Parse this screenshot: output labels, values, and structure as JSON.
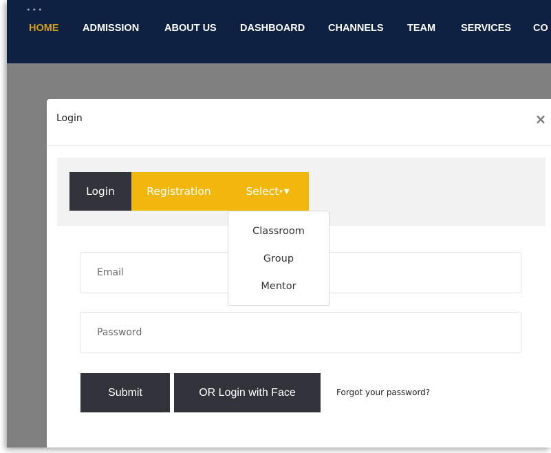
{
  "navbar": {
    "items": [
      {
        "label": "HOME",
        "active": true
      },
      {
        "label": "ADMISSION"
      },
      {
        "label": "ABOUT US"
      },
      {
        "label": "DASHBOARD"
      },
      {
        "label": "CHANNELS"
      },
      {
        "label": "TEAM"
      },
      {
        "label": "SERVICES"
      },
      {
        "label": "CO"
      }
    ],
    "dots": "•••",
    "colors": {
      "background": "#0f2143",
      "active": "#d4a017",
      "text": "#ffffff"
    }
  },
  "modal": {
    "title": "Login",
    "close_glyph": "×",
    "tabs": {
      "login": "Login",
      "registration": "Registration",
      "select": "Select",
      "select_caret_small": "▾",
      "select_caret": "▼"
    },
    "dropdown": {
      "options": [
        "Classroom",
        "Group",
        "Mentor"
      ]
    },
    "form": {
      "email_placeholder": "Email",
      "email_value": "",
      "password_placeholder": "Password",
      "password_value": "",
      "submit_label": "Submit",
      "face_login_label": "OR Login with Face",
      "forgot_password": "Forgot your password?"
    },
    "colors": {
      "accent": "#f2b70c",
      "dark": "#30343a",
      "panel": "#f2f2f2"
    }
  }
}
